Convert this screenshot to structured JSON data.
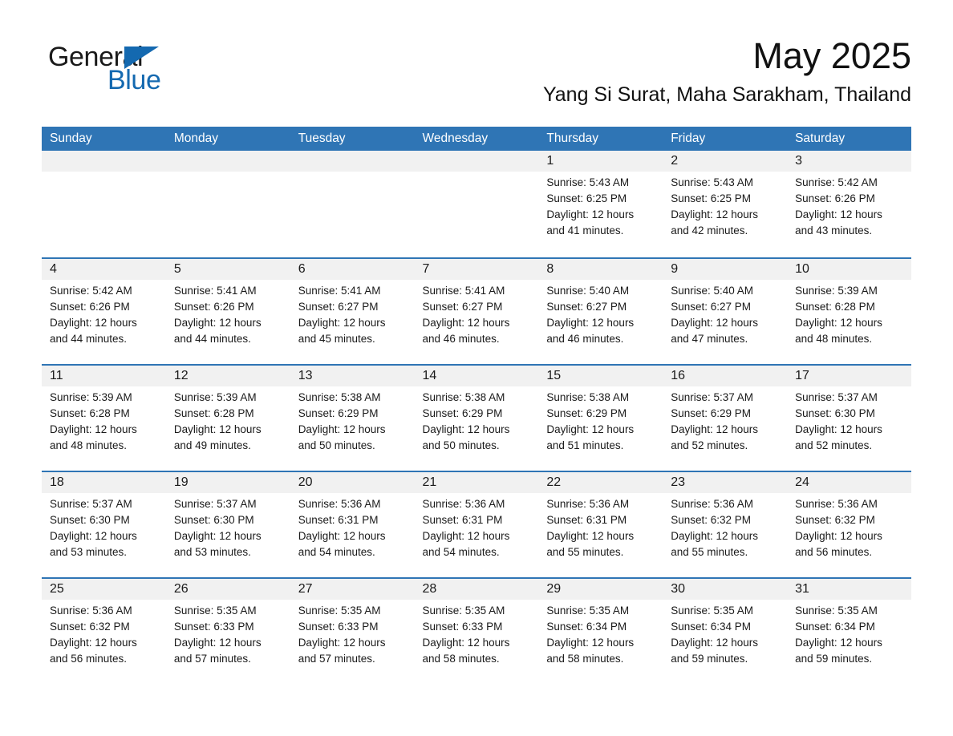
{
  "brand": {
    "name_part1": "General",
    "name_part2": "Blue",
    "logo_icon": "triangle-flag-icon",
    "color_blue": "#1469b0"
  },
  "header": {
    "month_title": "May 2025",
    "location": "Yang Si Surat, Maha Sarakham, Thailand"
  },
  "theme": {
    "header_blue": "#2f75b5",
    "daynum_band": "#f1f1f1",
    "text": "#1a1a1a"
  },
  "weekday_headers": [
    "Sunday",
    "Monday",
    "Tuesday",
    "Wednesday",
    "Thursday",
    "Friday",
    "Saturday"
  ],
  "weeks": [
    {
      "days": [
        {
          "num": "",
          "lines": [
            "",
            "",
            "",
            ""
          ],
          "empty": true
        },
        {
          "num": "",
          "lines": [
            "",
            "",
            "",
            ""
          ],
          "empty": true
        },
        {
          "num": "",
          "lines": [
            "",
            "",
            "",
            ""
          ],
          "empty": true
        },
        {
          "num": "",
          "lines": [
            "",
            "",
            "",
            ""
          ],
          "empty": true
        },
        {
          "num": "1",
          "lines": [
            "Sunrise: 5:43 AM",
            "Sunset: 6:25 PM",
            "Daylight: 12 hours",
            "and 41 minutes."
          ],
          "empty": false
        },
        {
          "num": "2",
          "lines": [
            "Sunrise: 5:43 AM",
            "Sunset: 6:25 PM",
            "Daylight: 12 hours",
            "and 42 minutes."
          ],
          "empty": false
        },
        {
          "num": "3",
          "lines": [
            "Sunrise: 5:42 AM",
            "Sunset: 6:26 PM",
            "Daylight: 12 hours",
            "and 43 minutes."
          ],
          "empty": false
        }
      ]
    },
    {
      "days": [
        {
          "num": "4",
          "lines": [
            "Sunrise: 5:42 AM",
            "Sunset: 6:26 PM",
            "Daylight: 12 hours",
            "and 44 minutes."
          ],
          "empty": false
        },
        {
          "num": "5",
          "lines": [
            "Sunrise: 5:41 AM",
            "Sunset: 6:26 PM",
            "Daylight: 12 hours",
            "and 44 minutes."
          ],
          "empty": false
        },
        {
          "num": "6",
          "lines": [
            "Sunrise: 5:41 AM",
            "Sunset: 6:27 PM",
            "Daylight: 12 hours",
            "and 45 minutes."
          ],
          "empty": false
        },
        {
          "num": "7",
          "lines": [
            "Sunrise: 5:41 AM",
            "Sunset: 6:27 PM",
            "Daylight: 12 hours",
            "and 46 minutes."
          ],
          "empty": false
        },
        {
          "num": "8",
          "lines": [
            "Sunrise: 5:40 AM",
            "Sunset: 6:27 PM",
            "Daylight: 12 hours",
            "and 46 minutes."
          ],
          "empty": false
        },
        {
          "num": "9",
          "lines": [
            "Sunrise: 5:40 AM",
            "Sunset: 6:27 PM",
            "Daylight: 12 hours",
            "and 47 minutes."
          ],
          "empty": false
        },
        {
          "num": "10",
          "lines": [
            "Sunrise: 5:39 AM",
            "Sunset: 6:28 PM",
            "Daylight: 12 hours",
            "and 48 minutes."
          ],
          "empty": false
        }
      ]
    },
    {
      "days": [
        {
          "num": "11",
          "lines": [
            "Sunrise: 5:39 AM",
            "Sunset: 6:28 PM",
            "Daylight: 12 hours",
            "and 48 minutes."
          ],
          "empty": false
        },
        {
          "num": "12",
          "lines": [
            "Sunrise: 5:39 AM",
            "Sunset: 6:28 PM",
            "Daylight: 12 hours",
            "and 49 minutes."
          ],
          "empty": false
        },
        {
          "num": "13",
          "lines": [
            "Sunrise: 5:38 AM",
            "Sunset: 6:29 PM",
            "Daylight: 12 hours",
            "and 50 minutes."
          ],
          "empty": false
        },
        {
          "num": "14",
          "lines": [
            "Sunrise: 5:38 AM",
            "Sunset: 6:29 PM",
            "Daylight: 12 hours",
            "and 50 minutes."
          ],
          "empty": false
        },
        {
          "num": "15",
          "lines": [
            "Sunrise: 5:38 AM",
            "Sunset: 6:29 PM",
            "Daylight: 12 hours",
            "and 51 minutes."
          ],
          "empty": false
        },
        {
          "num": "16",
          "lines": [
            "Sunrise: 5:37 AM",
            "Sunset: 6:29 PM",
            "Daylight: 12 hours",
            "and 52 minutes."
          ],
          "empty": false
        },
        {
          "num": "17",
          "lines": [
            "Sunrise: 5:37 AM",
            "Sunset: 6:30 PM",
            "Daylight: 12 hours",
            "and 52 minutes."
          ],
          "empty": false
        }
      ]
    },
    {
      "days": [
        {
          "num": "18",
          "lines": [
            "Sunrise: 5:37 AM",
            "Sunset: 6:30 PM",
            "Daylight: 12 hours",
            "and 53 minutes."
          ],
          "empty": false
        },
        {
          "num": "19",
          "lines": [
            "Sunrise: 5:37 AM",
            "Sunset: 6:30 PM",
            "Daylight: 12 hours",
            "and 53 minutes."
          ],
          "empty": false
        },
        {
          "num": "20",
          "lines": [
            "Sunrise: 5:36 AM",
            "Sunset: 6:31 PM",
            "Daylight: 12 hours",
            "and 54 minutes."
          ],
          "empty": false
        },
        {
          "num": "21",
          "lines": [
            "Sunrise: 5:36 AM",
            "Sunset: 6:31 PM",
            "Daylight: 12 hours",
            "and 54 minutes."
          ],
          "empty": false
        },
        {
          "num": "22",
          "lines": [
            "Sunrise: 5:36 AM",
            "Sunset: 6:31 PM",
            "Daylight: 12 hours",
            "and 55 minutes."
          ],
          "empty": false
        },
        {
          "num": "23",
          "lines": [
            "Sunrise: 5:36 AM",
            "Sunset: 6:32 PM",
            "Daylight: 12 hours",
            "and 55 minutes."
          ],
          "empty": false
        },
        {
          "num": "24",
          "lines": [
            "Sunrise: 5:36 AM",
            "Sunset: 6:32 PM",
            "Daylight: 12 hours",
            "and 56 minutes."
          ],
          "empty": false
        }
      ]
    },
    {
      "days": [
        {
          "num": "25",
          "lines": [
            "Sunrise: 5:36 AM",
            "Sunset: 6:32 PM",
            "Daylight: 12 hours",
            "and 56 minutes."
          ],
          "empty": false
        },
        {
          "num": "26",
          "lines": [
            "Sunrise: 5:35 AM",
            "Sunset: 6:33 PM",
            "Daylight: 12 hours",
            "and 57 minutes."
          ],
          "empty": false
        },
        {
          "num": "27",
          "lines": [
            "Sunrise: 5:35 AM",
            "Sunset: 6:33 PM",
            "Daylight: 12 hours",
            "and 57 minutes."
          ],
          "empty": false
        },
        {
          "num": "28",
          "lines": [
            "Sunrise: 5:35 AM",
            "Sunset: 6:33 PM",
            "Daylight: 12 hours",
            "and 58 minutes."
          ],
          "empty": false
        },
        {
          "num": "29",
          "lines": [
            "Sunrise: 5:35 AM",
            "Sunset: 6:34 PM",
            "Daylight: 12 hours",
            "and 58 minutes."
          ],
          "empty": false
        },
        {
          "num": "30",
          "lines": [
            "Sunrise: 5:35 AM",
            "Sunset: 6:34 PM",
            "Daylight: 12 hours",
            "and 59 minutes."
          ],
          "empty": false
        },
        {
          "num": "31",
          "lines": [
            "Sunrise: 5:35 AM",
            "Sunset: 6:34 PM",
            "Daylight: 12 hours",
            "and 59 minutes."
          ],
          "empty": false
        }
      ]
    }
  ]
}
